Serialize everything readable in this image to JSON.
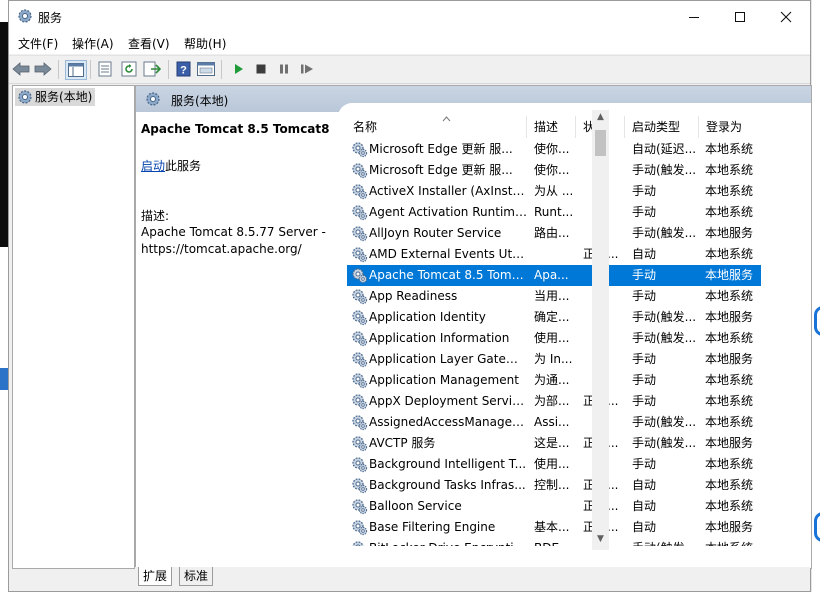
{
  "window": {
    "title": "服务"
  },
  "menu": [
    "文件(F)",
    "操作(A)",
    "查看(V)",
    "帮助(H)"
  ],
  "tree": {
    "root": "服务(本地)"
  },
  "pane": {
    "header": "服务(本地)"
  },
  "details": {
    "service_name": "Apache Tomcat 8.5 Tomcat8",
    "start_link": "启动",
    "start_suffix": "此服务",
    "desc_label": "描述:",
    "desc_text": "Apache Tomcat 8.5.77 Server - https://tomcat.apache.org/"
  },
  "columns": {
    "name": "名称",
    "desc": "描述",
    "status": "状态",
    "startup": "启动类型",
    "logon": "登录为"
  },
  "services": [
    {
      "name": "Microsoft Edge 更新 服...",
      "desc": "使你...",
      "status": "",
      "startup": "自动(延迟...",
      "logon": "本地系统"
    },
    {
      "name": "Microsoft Edge 更新 服...",
      "desc": "使你...",
      "status": "",
      "startup": "手动(触发...",
      "logon": "本地系统"
    },
    {
      "name": "ActiveX Installer (AxInstSV)",
      "desc": "为从 ...",
      "status": "",
      "startup": "手动",
      "logon": "本地系统"
    },
    {
      "name": "Agent Activation Runtime...",
      "desc": "Runt...",
      "status": "",
      "startup": "手动",
      "logon": "本地系统"
    },
    {
      "name": "AllJoyn Router Service",
      "desc": "路由...",
      "status": "",
      "startup": "手动(触发...",
      "logon": "本地服务"
    },
    {
      "name": "AMD External Events Utility",
      "desc": "",
      "status": "正在...",
      "startup": "自动",
      "logon": "本地系统"
    },
    {
      "name": "Apache Tomcat 8.5 Tomc...",
      "desc": "Apa...",
      "status": "",
      "startup": "手动",
      "logon": "本地服务",
      "selected": true
    },
    {
      "name": "App Readiness",
      "desc": "当用...",
      "status": "",
      "startup": "手动",
      "logon": "本地系统"
    },
    {
      "name": "Application Identity",
      "desc": "确定...",
      "status": "",
      "startup": "手动(触发...",
      "logon": "本地服务"
    },
    {
      "name": "Application Information",
      "desc": "使用...",
      "status": "",
      "startup": "手动(触发...",
      "logon": "本地系统"
    },
    {
      "name": "Application Layer Gatewa...",
      "desc": "为 In...",
      "status": "",
      "startup": "手动",
      "logon": "本地服务"
    },
    {
      "name": "Application Management",
      "desc": "为通...",
      "status": "",
      "startup": "手动",
      "logon": "本地系统"
    },
    {
      "name": "AppX Deployment Servic...",
      "desc": "为部...",
      "status": "正在...",
      "startup": "手动",
      "logon": "本地系统"
    },
    {
      "name": "AssignedAccessManager...",
      "desc": "Assi...",
      "status": "",
      "startup": "手动(触发...",
      "logon": "本地系统"
    },
    {
      "name": "AVCTP 服务",
      "desc": "这是...",
      "status": "正在...",
      "startup": "手动(触发...",
      "logon": "本地服务"
    },
    {
      "name": "Background Intelligent T...",
      "desc": "使用...",
      "status": "",
      "startup": "手动",
      "logon": "本地系统"
    },
    {
      "name": "Background Tasks Infras...",
      "desc": "控制...",
      "status": "正在...",
      "startup": "自动",
      "logon": "本地系统"
    },
    {
      "name": "Balloon Service",
      "desc": "",
      "status": "正在...",
      "startup": "自动",
      "logon": "本地系统"
    },
    {
      "name": "Base Filtering Engine",
      "desc": "基本...",
      "status": "正在...",
      "startup": "自动",
      "logon": "本地服务"
    },
    {
      "name": "BitLocker Drive Encryptio...",
      "desc": "BDE...",
      "status": "",
      "startup": "手动(触发...",
      "logon": "本地系统"
    }
  ],
  "tabs": [
    "扩展",
    "标准"
  ],
  "icons": {
    "app": "services-gear-icon",
    "toolbar": [
      "back-arrow-icon",
      "forward-arrow-icon",
      "show-tree-icon",
      "properties-icon",
      "refresh-icon",
      "export-list-icon",
      "help-icon",
      "console-view-icon",
      "start-service-icon",
      "stop-service-icon",
      "pause-service-icon",
      "restart-service-icon"
    ]
  },
  "colors": {
    "selection": "#0078d7",
    "header_gradient": "#c3cfdf"
  }
}
